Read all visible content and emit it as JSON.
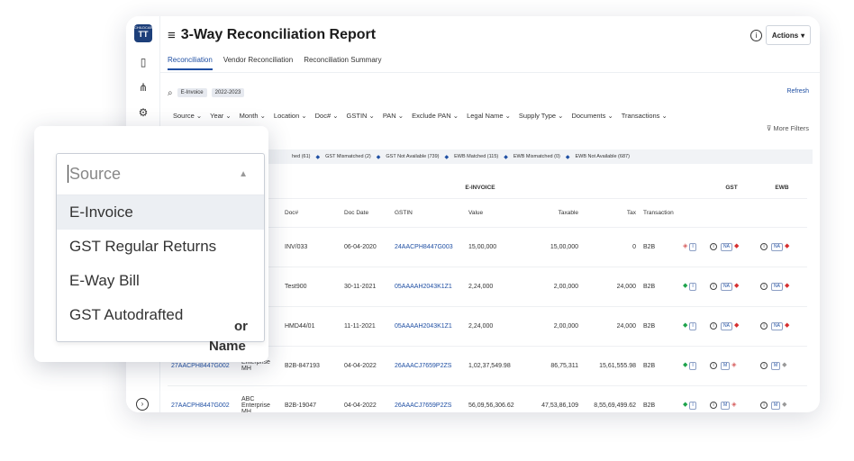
{
  "app": {
    "logo_small": "CHILDCARE",
    "logo_text": "TT",
    "title": "3-Way Reconciliation Report",
    "actions_label": "Actions"
  },
  "tabs": [
    "Reconciliation",
    "Vendor Reconciliation",
    "Reconciliation Summary"
  ],
  "search": {
    "chips": [
      "E-Invoice",
      "2022-2023"
    ],
    "refresh_label": "Refresh"
  },
  "filters": [
    "Source",
    "Year",
    "Month",
    "Location",
    "Doc#",
    "GSTIN",
    "PAN",
    "Exclude PAN",
    "Legal Name",
    "Supply Type",
    "Documents",
    "Transactions"
  ],
  "more_filters_label": "More Filters",
  "status": {
    "items": [
      "hed (61)",
      "GST Mismatched (2)",
      "GST Not Available (739)",
      "EWB Matched (115)",
      "EWB Mismatched (0)",
      "EWB Not Available (687)"
    ]
  },
  "table": {
    "group_headers": [
      "E-INVOICE",
      "GST",
      "EWB"
    ],
    "columns": [
      "Doc#",
      "Doc Date",
      "GSTIN",
      "Value",
      "Taxable",
      "Tax",
      "Transaction"
    ],
    "rows": [
      {
        "gstin1": "",
        "name": "e",
        "doc": "INV/033",
        "date": "06-04-2020",
        "gstin": "24AACPH8447G003",
        "value": "15,00,000",
        "taxable": "15,00,000",
        "tax": "0",
        "txn": "B2B"
      },
      {
        "gstin1": "",
        "name": "e",
        "doc": "Test900",
        "date": "30-11-2021",
        "gstin": "05AAAAH2043K1Z1",
        "value": "2,24,000",
        "taxable": "2,00,000",
        "tax": "24,000",
        "txn": "B2B"
      },
      {
        "gstin1": "",
        "name": "",
        "doc": "HMD44/01",
        "date": "11-11-2021",
        "gstin": "05AAAAH2043K1Z1",
        "value": "2,24,000",
        "taxable": "2,00,000",
        "tax": "24,000",
        "txn": "B2B"
      },
      {
        "gstin1": "27AACPH8447G002",
        "name": "Enterprise MH",
        "doc": "B2B-847193",
        "date": "04-04-2022",
        "gstin": "26AAACJ7659P2ZS",
        "value": "1,02,37,549.98",
        "taxable": "86,75,311",
        "tax": "15,61,555.98",
        "txn": "B2B"
      },
      {
        "gstin1": "27AACPH8447G002",
        "name": "ABC Enterprise MH",
        "doc": "B2B-19047",
        "date": "04-04-2022",
        "gstin": "26AAACJ7659P2ZS",
        "value": "56,09,56,306.62",
        "taxable": "47,53,86,109",
        "tax": "8,55,69,499.62",
        "txn": "B2B"
      }
    ],
    "gst_badges": [
      "NA",
      "NA",
      "NA",
      "M",
      "M"
    ],
    "ewb_badges": [
      "NA",
      "NA",
      "NA",
      "M",
      "M"
    ]
  },
  "dropdown": {
    "placeholder": "Source",
    "options": [
      "E-Invoice",
      "GST Regular Returns",
      "E-Way Bill",
      "GST Autodrafted"
    ],
    "peek_a": "or",
    "peek_b": "Name"
  }
}
